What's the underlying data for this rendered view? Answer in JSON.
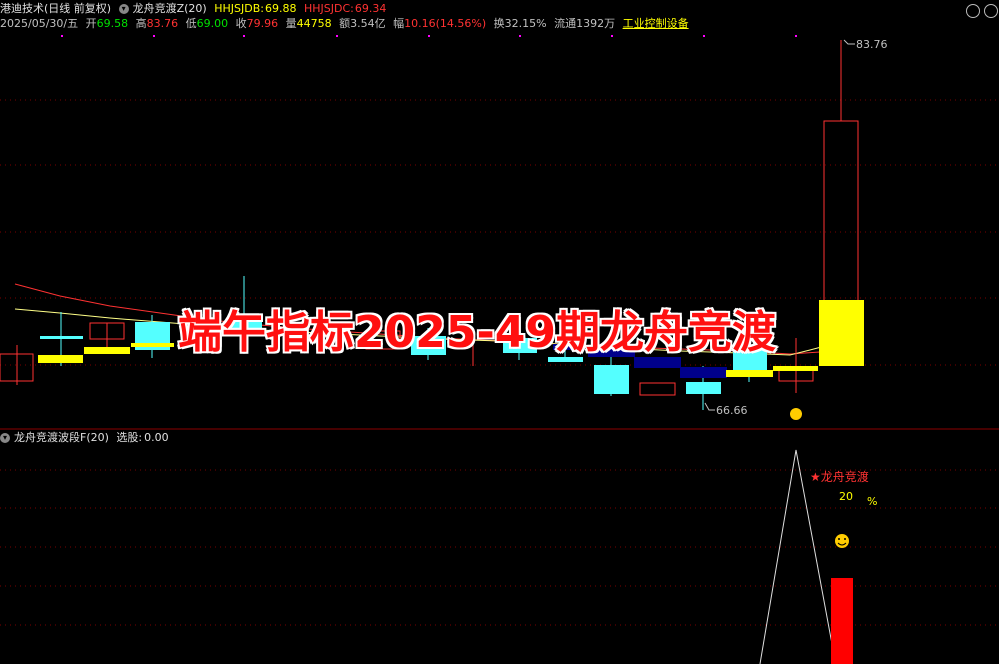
{
  "header": {
    "stock_name": "港迪技术",
    "period": "(日线 前复权)",
    "indicator_name": "龙舟竞渡Z(20)",
    "hhjsjdb_label": "HHJSJDB:",
    "hhjsjdb_value": "69.88",
    "hhjsjdc_label": "HHJSJDC:",
    "hhjsjdc_value": "69.34"
  },
  "info_row": {
    "date": "2025/05/30/五",
    "open_label": "开",
    "open": "69.58",
    "high_label": "高",
    "high": "83.76",
    "low_label": "低",
    "low": "69.00",
    "close_label": "收",
    "close": "79.96",
    "volume_label": "量",
    "volume": "44758",
    "amount_label": "额",
    "amount": "3.54亿",
    "change_label": "幅",
    "change": "10.16(14.56%)",
    "turnover_label": "换",
    "turnover": "32.15%",
    "float_label": "流通",
    "float": "1392万",
    "industry": "工业控制设备"
  },
  "main_chart": {
    "high_marker": "83.76",
    "low_marker": "66.66"
  },
  "overlay_title": "端午指标2025-49期龙舟竞渡",
  "sub_panel": {
    "indicator_name": "龙舟竞渡波段F(20)",
    "select_label": "选股:",
    "select_value": "0.00",
    "signal_label": "★龙舟竞渡",
    "signal_value": "20",
    "signal_unit": "%"
  },
  "colors": {
    "background": "#000000",
    "up_candle": "#ff3232",
    "down_candle": "#54ffff",
    "yellow_candle": "#ffff00",
    "navy_candle": "#00008b",
    "divider": "#8b0000"
  }
}
